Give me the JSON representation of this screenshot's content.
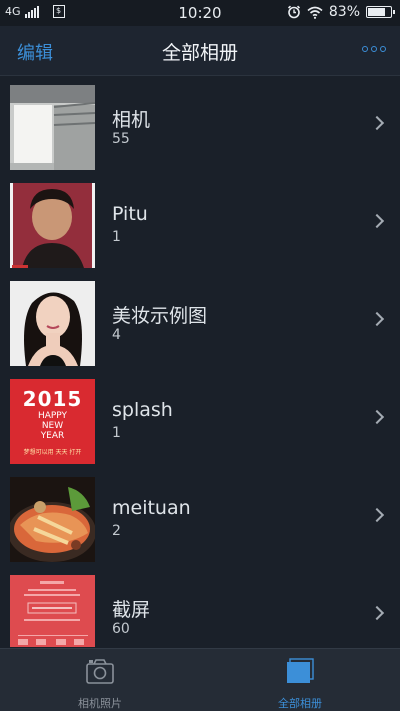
{
  "status_bar": {
    "network": "4G",
    "time": "10:20",
    "battery": "83%",
    "battery_level": 0.83,
    "icons": [
      "signal-icon",
      "sim-icon",
      "alarm-icon",
      "wifi-icon",
      "battery-icon"
    ]
  },
  "nav": {
    "edit_label": "编辑",
    "title": "全部相册",
    "more_icon": "more-dots-icon",
    "accent": "#3c8fd8"
  },
  "albums": [
    {
      "name": "相机",
      "count": "55",
      "thumb": "room-photo"
    },
    {
      "name": "Pitu",
      "count": "1",
      "thumb": "selfie-photo"
    },
    {
      "name": "美妆示例图",
      "count": "4",
      "thumb": "portrait-photo"
    },
    {
      "name": "splash",
      "count": "1",
      "thumb": "new-year-2015-card"
    },
    {
      "name": "meituan",
      "count": "2",
      "thumb": "food-photo"
    },
    {
      "name": "截屏",
      "count": "60",
      "thumb": "red-screenshot"
    }
  ],
  "splash_card": {
    "year": "2015",
    "line1": "HAPPY",
    "line2": "NEW",
    "line3": "YEAR",
    "caption": "梦想可以用 天天 打开"
  },
  "tabs": [
    {
      "label": "相机照片",
      "icon": "camera-icon",
      "active": false
    },
    {
      "label": "全部相册",
      "icon": "albums-icon",
      "active": true
    }
  ],
  "colors": {
    "background": "#1a2029",
    "tab_active": "#3c8fd8",
    "tab_inactive": "#8a919a"
  }
}
